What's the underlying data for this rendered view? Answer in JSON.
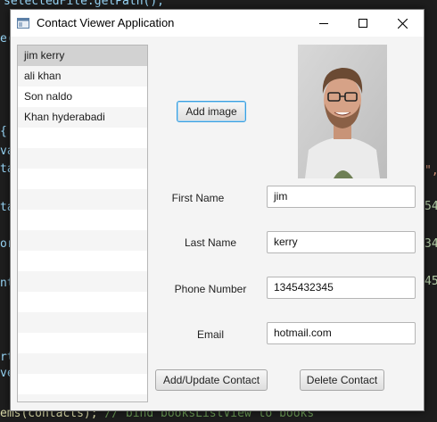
{
  "background_code": {
    "line1": "selectedFile.getPath();",
    "line2": "e(",
    "line_bottom_code": "ems(contacts); ",
    "line_bottom_comment": "// bind booksListView to books",
    "right_fragment_1": "\",",
    "right_fragment_2": "54",
    "right_fragment_3": "34",
    "right_fragment_4": "45",
    "left_fragments": [
      "{",
      "va",
      "ta",
      "ta",
      "or",
      "nt",
      "rt",
      "ve"
    ]
  },
  "window": {
    "title": "Contact Viewer Application",
    "controls": [
      "minimize-icon",
      "maximize-icon",
      "close-icon"
    ]
  },
  "contacts_list": {
    "items": [
      {
        "label": "jim kerry",
        "selected": true
      },
      {
        "label": "ali khan",
        "selected": false
      },
      {
        "label": "Son naldo",
        "selected": false
      },
      {
        "label": "Khan hyderabadi",
        "selected": false
      }
    ]
  },
  "form": {
    "add_image_label": "Add image",
    "first_name_label": "First Name",
    "first_name_value": "jim",
    "last_name_label": "Last Name",
    "last_name_value": "kerry",
    "phone_label": "Phone Number",
    "phone_value": "1345432345",
    "email_label": "Email",
    "email_value": "hotmail.com",
    "add_update_label": "Add/Update Contact",
    "delete_label": "Delete Contact"
  },
  "colors": {
    "focus_accent": "#3a9fdf",
    "selected_row": "#d2d2d2",
    "editor_background": "#1e1e1e"
  }
}
